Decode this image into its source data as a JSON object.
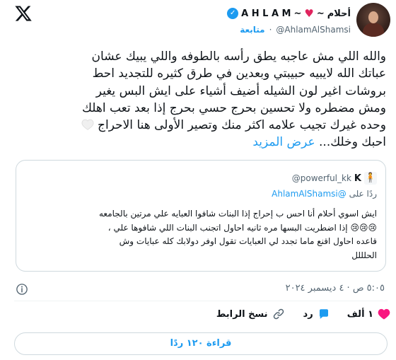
{
  "author": {
    "display_name": "أحلام",
    "name_prefix": "~",
    "name_latin": "A H L A M",
    "name_suffix": "~",
    "handle": "@AhlamAlShamsi",
    "follow_label": "متابعة"
  },
  "tweet": {
    "lines": [
      "والله اللي مش عاجبه يطق رأسه بالطوفه واللي يبيك عشان",
      "عباتك الله لايبيه حبيبتي وبعدين في طرق كثيره للتجديد احط",
      "بروشات اغير لون الشيله أضيف أشياء على ايش البس يغير",
      "ومش مضطره ولا تحسين بحرج حسي بحرج إذا بعد تعب اهلك",
      "وحده غيرك تجيب علامه اكثر منك وتصير الأولى هنا الاحراج"
    ],
    "last_line": "احبك وخلك...",
    "show_more": "عرض المزيد"
  },
  "quote": {
    "name": "K",
    "handle": "@powerful_kk",
    "reply_prefix": "ردًا على",
    "reply_to": "@AhlamAlShamsi",
    "lines": [
      "ايش اسوي أحلام أنا احس ب إحراج إذا البنات شافوا العبايه علي مرتين بالجامعه",
      "😢😢😢 إذا اضطريت البسها مره ثانيه احاول اتجنب البنات اللي شافوها علي ،",
      "قاعده احاول اقنع ماما تجدد لي العبايات تقول اوفر دولابك كله عبايات وش",
      "الحلللل"
    ]
  },
  "meta": {
    "timestamp": "٥:٠٥ ص · ٤ ديسمبر ٢٠٢٤"
  },
  "actions": {
    "like_count": "١ ألف",
    "reply_label": "رد",
    "copy_label": "نسخ الرابط"
  },
  "read_button": "قراءة ١٢٠ ردًا",
  "colors": {
    "accent": "#1d9bf0",
    "like": "#f91880",
    "text": "#0f1419",
    "secondary": "#536471",
    "border": "#cfd9de"
  },
  "icons": [
    "x-logo-icon",
    "verified-badge-icon",
    "red-heart-icon",
    "white-heart-icon",
    "info-icon",
    "heart-icon",
    "reply-icon",
    "link-icon",
    "avatar"
  ]
}
